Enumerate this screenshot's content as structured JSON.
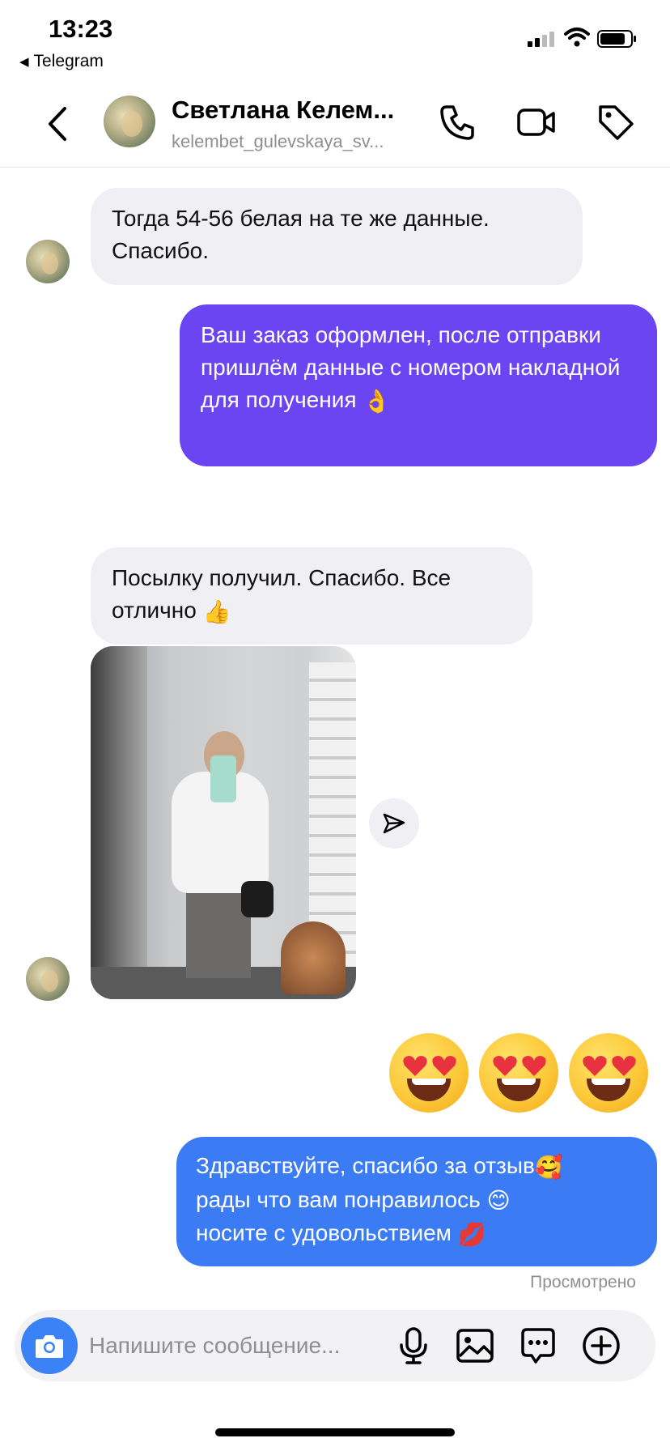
{
  "status_bar": {
    "time": "13:23",
    "back_app": "Telegram",
    "back_glyph": "◀"
  },
  "header": {
    "contact_name": "Светлана Келем...",
    "contact_username": "kelembet_gulevskaya_sv...",
    "icons": [
      "back-chevron-icon",
      "phone-icon",
      "video-camera-icon",
      "tag-icon"
    ]
  },
  "messages": [
    {
      "direction": "incoming",
      "text": "Тогда 54-56 белая на те же данные. Спасибо."
    },
    {
      "direction": "outgoing",
      "text": "Ваш заказ оформлен, после отправки пришлём данные с номером накладной для получения",
      "emoji": "👌"
    },
    {
      "direction": "incoming",
      "text": "Посылку получил. Спасибо. Все отлично",
      "emoji": "👍"
    },
    {
      "direction": "incoming",
      "type": "photo",
      "description_icon": "photo-attachment"
    },
    {
      "direction": "outgoing",
      "type": "emoji",
      "emoji": [
        "😍",
        "😍",
        "😍"
      ]
    },
    {
      "direction": "outgoing",
      "lines": [
        "Здравствуйте, спасибо за отзыв",
        "рады что вам понравилось",
        "носите с удовольствием"
      ],
      "emojis": [
        "🥰",
        "😊",
        "💋"
      ]
    }
  ],
  "seen_label": "Просмотрено",
  "composer": {
    "placeholder": "Напишите сообщение...",
    "icons": [
      "camera-icon",
      "microphone-icon",
      "gallery-icon",
      "sticker-icon",
      "plus-icon"
    ]
  },
  "colors": {
    "incoming_bubble": "#efeff4",
    "outgoing_purple": "#6a45f1",
    "outgoing_blue": "#3b7cf5",
    "camera_button": "#3b82f6",
    "muted_text": "#8e8e93"
  }
}
